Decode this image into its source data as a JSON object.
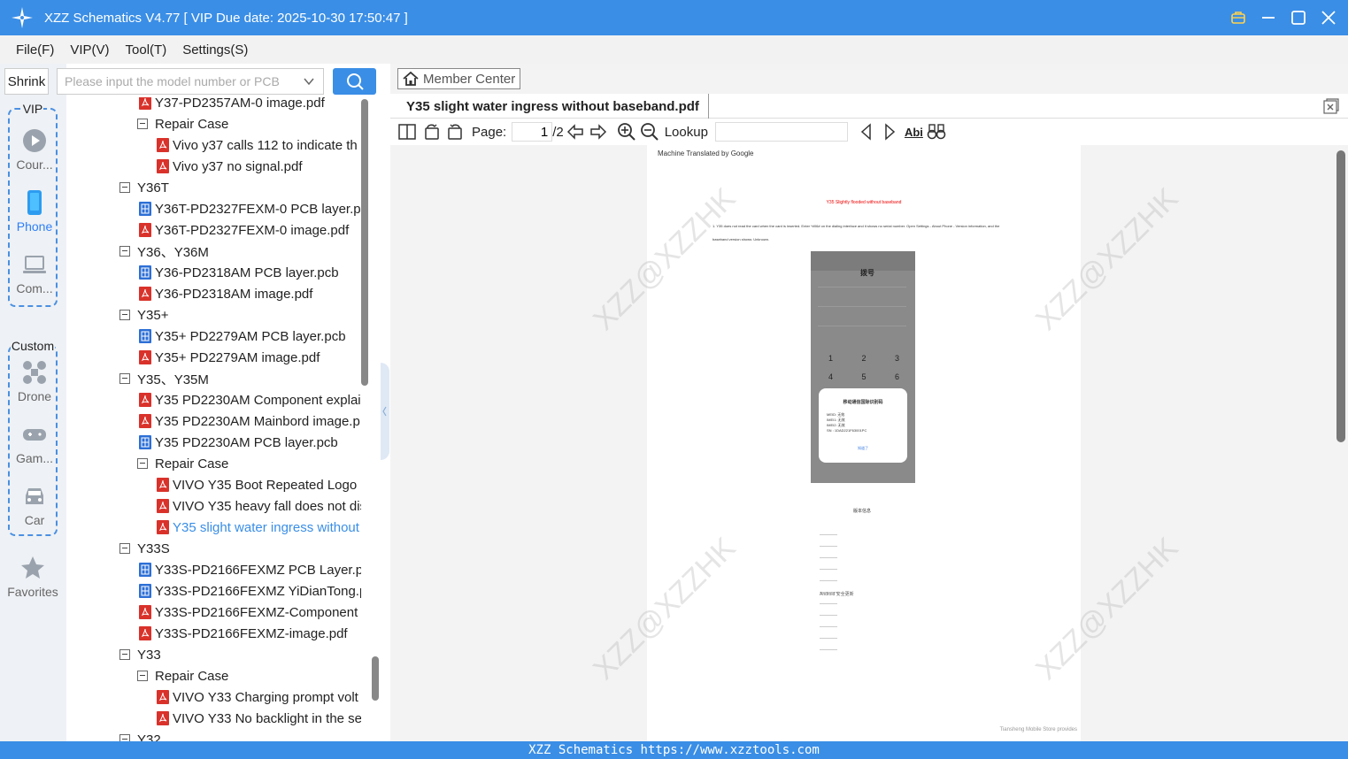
{
  "window": {
    "title": "XZZ Schematics V4.77 [ VIP Due date: 2025-10-30 17:50:47 ]"
  },
  "menu": [
    {
      "label": "File(F)"
    },
    {
      "label": "VIP(V)"
    },
    {
      "label": "Tool(T)"
    },
    {
      "label": "Settings(S)"
    }
  ],
  "sidebar": {
    "shrink_label": "Shrink",
    "vip_label": "VIP",
    "custom_label": "Custom",
    "items": [
      {
        "label": "Cour...",
        "icon": "play-icon"
      },
      {
        "label": "Phone",
        "icon": "phone-icon",
        "active": true
      },
      {
        "label": "Com...",
        "icon": "laptop-icon"
      },
      {
        "label": "Drone",
        "icon": "drone-icon"
      },
      {
        "label": "Gam...",
        "icon": "gamepad-icon"
      },
      {
        "label": "Car",
        "icon": "car-icon"
      },
      {
        "label": "Favorites",
        "icon": "star-icon"
      }
    ]
  },
  "search": {
    "placeholder": "Please input the model number or PCB"
  },
  "tree": [
    {
      "label": "Y37-PD2357AM-0 image.pdf",
      "type": "pdf",
      "level": 1
    },
    {
      "label": "Repair Case",
      "type": "folder",
      "level": 1
    },
    {
      "label": "Vivo y37 calls 112 to indicate th",
      "type": "pdf",
      "level": 2
    },
    {
      "label": "Vivo y37 no signal.pdf",
      "type": "pdf",
      "level": 2
    },
    {
      "label": "Y36T",
      "type": "folder",
      "level": 0
    },
    {
      "label": "Y36T-PD2327FEXM-0 PCB layer.pcl",
      "type": "pcb",
      "level": 1
    },
    {
      "label": "Y36T-PD2327FEXM-0 image.pdf",
      "type": "pdf",
      "level": 1
    },
    {
      "label": "Y36、Y36M",
      "type": "folder",
      "level": 0
    },
    {
      "label": "Y36-PD2318AM PCB layer.pcb",
      "type": "pcb",
      "level": 1
    },
    {
      "label": "Y36-PD2318AM image.pdf",
      "type": "pdf",
      "level": 1
    },
    {
      "label": "Y35+",
      "type": "folder",
      "level": 0
    },
    {
      "label": "Y35+ PD2279AM PCB layer.pcb",
      "type": "pcb",
      "level": 1
    },
    {
      "label": "Y35+ PD2279AM image.pdf",
      "type": "pdf",
      "level": 1
    },
    {
      "label": "Y35、Y35M",
      "type": "folder",
      "level": 0
    },
    {
      "label": "Y35 PD2230AM Component explai",
      "type": "pdf",
      "level": 1
    },
    {
      "label": "Y35 PD2230AM Mainbord image.p",
      "type": "pdf",
      "level": 1
    },
    {
      "label": "Y35 PD2230AM PCB layer.pcb",
      "type": "pcb",
      "level": 1
    },
    {
      "label": "Repair Case",
      "type": "folder",
      "level": 1
    },
    {
      "label": "VIVO Y35 Boot Repeated Logo F",
      "type": "pdf",
      "level": 2
    },
    {
      "label": "VIVO Y35 heavy fall does not dis",
      "type": "pdf",
      "level": 2
    },
    {
      "label": "Y35 slight water ingress without",
      "type": "pdf",
      "level": 2,
      "selected": true
    },
    {
      "label": "Y33S",
      "type": "folder",
      "level": 0
    },
    {
      "label": "Y33S-PD2166FEXMZ PCB Layer.pcb",
      "type": "pcb",
      "level": 1
    },
    {
      "label": "Y33S-PD2166FEXMZ YiDianTong.p",
      "type": "pcb",
      "level": 1
    },
    {
      "label": "Y33S-PD2166FEXMZ-Component e",
      "type": "pdf",
      "level": 1
    },
    {
      "label": "Y33S-PD2166FEXMZ-image.pdf",
      "type": "pdf",
      "level": 1
    },
    {
      "label": "Y33",
      "type": "folder",
      "level": 0
    },
    {
      "label": "Repair Case",
      "type": "folder",
      "level": 1
    },
    {
      "label": "VIVO Y33 Charging prompt volt",
      "type": "pdf",
      "level": 2
    },
    {
      "label": "VIVO Y33 No backlight in the se",
      "type": "pdf",
      "level": 2
    },
    {
      "label": "Y32",
      "type": "folder",
      "level": 0
    }
  ],
  "viewer": {
    "member_center_label": "Member Center",
    "doc_tab_label": "Y35 slight water ingress without baseband.pdf",
    "page_label": "Page:",
    "page_current": "1",
    "page_total": "/2",
    "lookup_label": "Lookup",
    "abi_label": "Abi"
  },
  "pdf": {
    "header": "Machine Translated by Google",
    "red_title": "Y35 Slightly flooded without baseband",
    "paragraph": "1. Y35 does not read the card when the card is inserted. Enter *#06# on the dialing interface and it shows no serial number. Open Settings - About Phone - Version information, and the baseband version shows: Unknown.",
    "dialog_title": "移动通信国际识别码",
    "dialog_lines": [
      "MEID: 无效",
      "IMEI1: 无效",
      "IMEI2: 无效",
      "SN : 1DAD221F63001PC"
    ],
    "dialog_ok": "知道了",
    "phone_title": "拨号",
    "phone2_title": "版本信息",
    "phone2_footer": "Android 安全更新",
    "watermark": "XZZ@XZZHK",
    "footnote": "Tiansheng Mobile Store provides"
  },
  "status": {
    "text": "XZZ Schematics https://www.xzztools.com"
  },
  "colors": {
    "accent": "#3a8ee6",
    "pdf_icon": "#d9322b",
    "pcb_icon": "#2d6fd6",
    "selected_text": "#3a8ee6"
  }
}
